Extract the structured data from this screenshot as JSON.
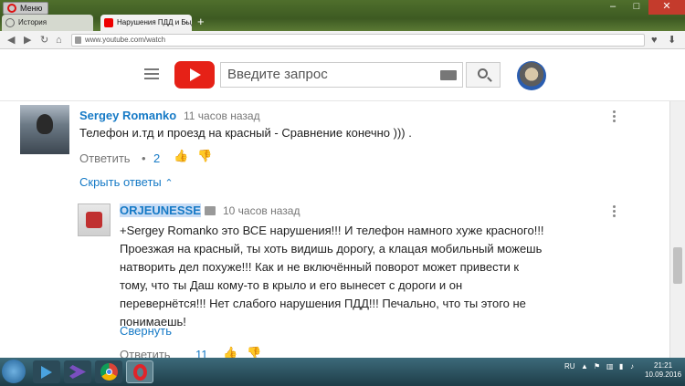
{
  "browser": {
    "menu_label": "Меню",
    "tabs": [
      {
        "label": "История",
        "active": false
      },
      {
        "label": "Нарушения ПДД и Быдло",
        "active": true
      }
    ],
    "new_tab": "+",
    "url": "www.youtube.com/watch",
    "window_controls": {
      "minimize": "–",
      "maximize": "□",
      "close": "✕"
    }
  },
  "youtube": {
    "search_placeholder": "Введите запрос"
  },
  "comments": [
    {
      "author": "Sergey Romanko",
      "time": "11 часов назад",
      "text": "Телефон и.тд  и проезд на красный - Сравнение конечно ))) .",
      "reply_label": "Ответить",
      "separator": "•",
      "likes": "2"
    }
  ],
  "hide_replies_label": "Скрыть ответы",
  "reply": {
    "author": "ORJEUNESSE",
    "time": "10 часов назад",
    "lines": [
      "+Sergey Romanko это ВСЕ нарушения!!! И телефон намного хуже красного!!!",
      "Проезжая на красный, ты хоть видишь дорогу, а клацая мобильный можешь",
      "натворить дел похуже!!! Как и не включённый поворот может привести к",
      "тому, что ты Даш кому-то в крыло и его вынесет с дороги и он",
      "перевернётся!!! Нет слабого нарушения ПДД!!! Печально, что ты этого не",
      "понимаешь!"
    ],
    "collapse_label": "Свернуть",
    "reply_label": "Ответить",
    "likes": "11"
  },
  "taskbar": {
    "lang": "RU",
    "time": "21:21",
    "date": "10.09.2016"
  }
}
